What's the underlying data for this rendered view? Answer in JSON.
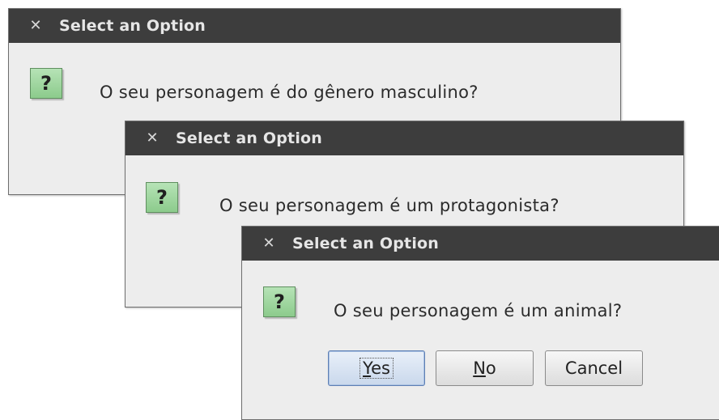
{
  "dialogs": [
    {
      "title": "Select an Option",
      "message": "O seu personagem é do gênero masculino?"
    },
    {
      "title": "Select an Option",
      "message": "O seu personagem é um protagonista?"
    },
    {
      "title": "Select an Option",
      "message": "O seu personagem é um animal?",
      "buttons": {
        "yes": {
          "mnemonic": "Y",
          "rest": "es"
        },
        "no": {
          "mnemonic": "N",
          "rest": "o"
        },
        "cancel": "Cancel"
      }
    }
  ],
  "icons": {
    "close": "close-icon",
    "question": "question-icon",
    "question_glyph": "?"
  },
  "colors": {
    "titlebar": "#3d3d3d",
    "dialog_background": "#ededed",
    "icon_green": "#9fd89f",
    "primary_button": "#c9d8ec"
  }
}
